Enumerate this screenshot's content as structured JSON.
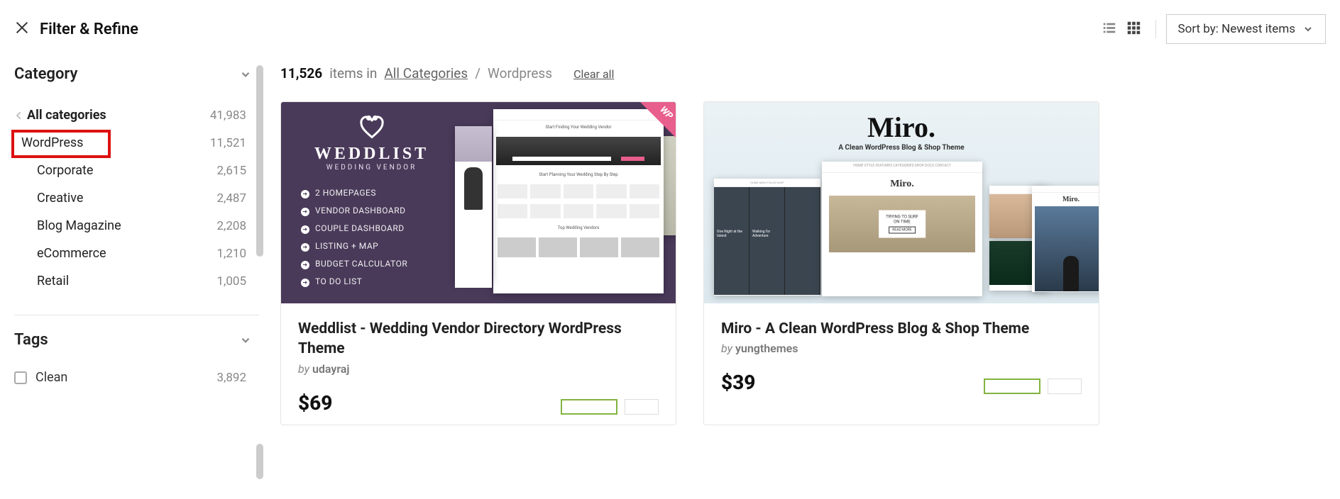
{
  "header": {
    "filter_title": "Filter & Refine",
    "sort_label": "Sort by: Newest items"
  },
  "sidebar": {
    "category_heading": "Category",
    "categories": [
      {
        "label": "All categories",
        "count": "41,983",
        "level": 0,
        "all": true
      },
      {
        "label": "WordPress",
        "count": "11,521",
        "level": 1,
        "highlighted": true
      },
      {
        "label": "Corporate",
        "count": "2,615",
        "level": 2
      },
      {
        "label": "Creative",
        "count": "2,487",
        "level": 2
      },
      {
        "label": "Blog Magazine",
        "count": "2,208",
        "level": 2
      },
      {
        "label": "eCommerce",
        "count": "1,210",
        "level": 2
      },
      {
        "label": "Retail",
        "count": "1,005",
        "level": 2
      }
    ],
    "tags_heading": "Tags",
    "tags": [
      {
        "label": "Clean",
        "count": "3,892"
      }
    ]
  },
  "results": {
    "count": "11,526",
    "in_text": "items in",
    "breadcrumb_root": "All Categories",
    "breadcrumb_current": "Wordpress",
    "clear_all": "Clear all"
  },
  "items": [
    {
      "title": "Weddlist - Wedding Vendor Directory WordPress Theme",
      "author": "udayraj",
      "by": "by",
      "price": "$69",
      "corner_badge": "WP",
      "preview": {
        "brand": "WEDDLIST",
        "subbrand": "WEDDING VENDOR",
        "features": [
          "2 HOMEPAGES",
          "VENDOR DASHBOARD",
          "COUPLE DASHBOARD",
          "LISTING + MAP",
          "BUDGET CALCULATOR",
          "TO DO LIST"
        ],
        "mock_heading1": "Start Finding Your Wedding Vendor",
        "mock_heading2": "Start Planning Your Wedding Step By Step",
        "mock_heading3": "Top Wedding Vendors"
      }
    },
    {
      "title": "Miro - A Clean WordPress Blog & Shop Theme",
      "author": "yungthemes",
      "by": "by",
      "price": "$39",
      "preview": {
        "brand": "Miro.",
        "subbrand": "A Clean WordPress Blog & Shop Theme",
        "inner_brand": "Miro.",
        "side_brand": "Miro.",
        "captions": [
          "One Night at the Island",
          "Walking for Adventure"
        ],
        "overlay_line1": "TRYING TO SURF",
        "overlay_line2": "ON TIME",
        "overlay_btn": "READ MORE"
      }
    }
  ]
}
